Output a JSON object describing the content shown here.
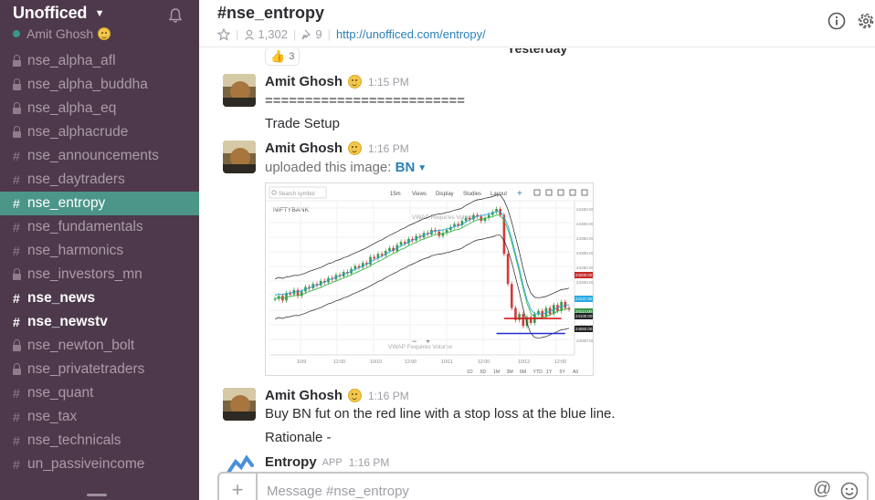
{
  "sidebar": {
    "team_name": "Unofficed",
    "user_name": "Amit Ghosh",
    "channels": [
      {
        "name": "nse_alpha_afl",
        "private": true
      },
      {
        "name": "nse_alpha_buddha",
        "private": true
      },
      {
        "name": "nse_alpha_eq",
        "private": true
      },
      {
        "name": "nse_alphacrude",
        "private": true
      },
      {
        "name": "nse_announcements",
        "private": false
      },
      {
        "name": "nse_daytraders",
        "private": false
      },
      {
        "name": "nse_entropy",
        "private": false,
        "active": true
      },
      {
        "name": "nse_fundamentals",
        "private": false
      },
      {
        "name": "nse_harmonics",
        "private": false
      },
      {
        "name": "nse_investors_mn",
        "private": true
      },
      {
        "name": "nse_news",
        "private": false,
        "unread": true
      },
      {
        "name": "nse_newstv",
        "private": false,
        "unread": true
      },
      {
        "name": "nse_newton_bolt",
        "private": true
      },
      {
        "name": "nse_privatetraders",
        "private": true
      },
      {
        "name": "nse_quant",
        "private": false
      },
      {
        "name": "nse_tax",
        "private": false
      },
      {
        "name": "nse_technicals",
        "private": false
      },
      {
        "name": "un_passiveincome",
        "private": false
      }
    ]
  },
  "header": {
    "channel_title": "#nse_entropy",
    "member_count": "1,302",
    "pinned_count": "9",
    "link": "http://unofficed.com/entropy/"
  },
  "messages": {
    "day_divider": "Yesterday",
    "reaction_count": "3",
    "items": [
      {
        "sender": "Amit Ghosh",
        "time": "1:15 PM",
        "lines": [
          "=========================",
          "Trade Setup"
        ]
      },
      {
        "sender": "Amit Ghosh",
        "time": "1:16 PM",
        "uploaded_text": "uploaded this image:",
        "file_name": "BN"
      },
      {
        "sender": "Amit Ghosh",
        "time": "1:16 PM",
        "lines": [
          "Buy BN fut on the red line with a stop loss at the blue line.",
          "Rationale -"
        ]
      },
      {
        "sender": "Entropy",
        "badge": "APP",
        "time": "1:16 PM"
      }
    ]
  },
  "chart": {
    "search_placeholder": "Search symbol",
    "symbol": "NIFTYBANK",
    "toolbar": [
      "15m",
      "Views",
      "Display",
      "Studies",
      "Layout"
    ],
    "indicator_note": "VWAP Requires Volume",
    "indicator_note_bottom": "VWAP Requires Volume",
    "x_ticks": [
      "10/9",
      "12:00",
      "10/10",
      "12:00",
      "10/11",
      "12:00",
      "10/12",
      "12:00"
    ],
    "y_ticks": [
      "24450.00",
      "24400.00",
      "24350.00",
      "24300.00",
      "24250.00",
      "24200.00",
      "24150.00",
      "24100.00",
      "24050.00",
      "24000.00"
    ],
    "price_tags": [
      "24200.00",
      "24147.50",
      "24114.00",
      "24100.00",
      "24060.00"
    ],
    "periods": [
      "1D",
      "5D",
      "1M",
      "3M",
      "6M",
      "YTD",
      "1Y",
      "5Y",
      "All"
    ],
    "colors": {
      "red_line": "#d81b1b",
      "blue_line": "#1c2fd6",
      "bb_band": "#222222",
      "sma": "#3bb54a",
      "ema": "#29a8e0"
    }
  },
  "composer": {
    "placeholder": "Message #nse_entropy"
  },
  "colors": {
    "sidebar_bg": "#4d394b",
    "active_channel": "#4c9689",
    "link": "#2a80b9"
  }
}
